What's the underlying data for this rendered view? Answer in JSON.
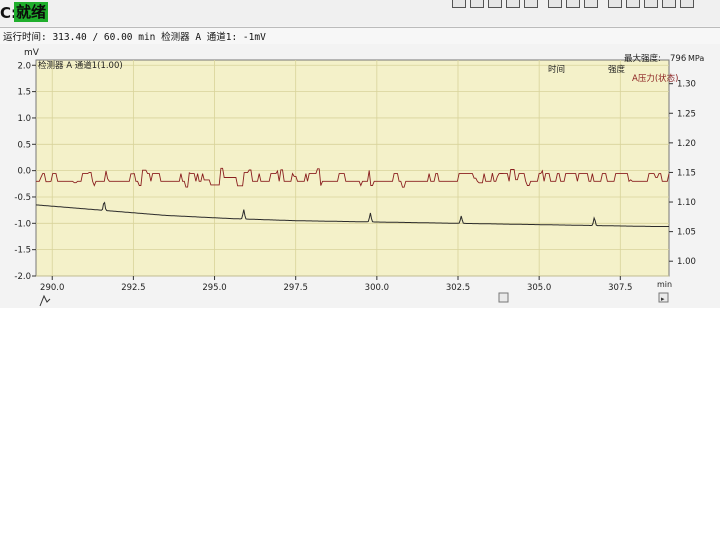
{
  "status": {
    "prefix": "C:",
    "badge": "就绪"
  },
  "runtime": {
    "text": "运行时间: 313.40 / 60.00 min 检测器 A 通道1: -1mV"
  },
  "legend": {
    "channel": "检测器 A 通道1(1.00)",
    "time_header": "时间",
    "intensity_header": "强度",
    "max_intensity_label": "最大强度:",
    "max_intensity_value": "796",
    "right_unit": "MPa",
    "pressure_label": "A压力(状态)"
  },
  "colors": {
    "status_badge": "#1fae2c",
    "plot_bg": "#f4f1c9",
    "pressure_trace": "#8a1f1f",
    "detector_trace": "#2b2b2b",
    "grid": "#d8d39a"
  },
  "chart_data": {
    "type": "line",
    "xlabel": "min",
    "ylabel": "mV",
    "y2label": "MPa",
    "xlim": [
      289.5,
      309.0
    ],
    "ylim": [
      -2.0,
      2.1
    ],
    "y2lim": [
      0.975,
      1.34
    ],
    "x_ticks": [
      290.0,
      292.5,
      295.0,
      297.5,
      300.0,
      302.5,
      305.0,
      307.5
    ],
    "x_tick_labels": [
      "290.0",
      "292.5",
      "295.0",
      "297.5",
      "300.0",
      "302.5",
      "305.0",
      "307.5"
    ],
    "y_ticks": [
      2.0,
      1.5,
      1.0,
      0.5,
      0.0,
      -0.5,
      -1.0,
      -1.5,
      -2.0
    ],
    "y_tick_labels": [
      "2.0",
      "1.5",
      "1.0",
      "0.5",
      "0.0",
      "-0.5",
      "-1.0",
      "-1.5",
      "-2.0"
    ],
    "y2_ticks": [
      1.3,
      1.25,
      1.2,
      1.15,
      1.1,
      1.05,
      1.0
    ],
    "y2_tick_labels": [
      "1.30",
      "1.25",
      "1.20",
      "1.15",
      "1.10",
      "1.05",
      "1.00"
    ],
    "series": [
      {
        "name": "检测器 A 通道1(1.00)",
        "axis": "left",
        "x": [
          289.5,
          290.5,
          291.5,
          292.5,
          293.5,
          294.5,
          295.5,
          296.5,
          297.5,
          298.5,
          299.5,
          300.5,
          301.5,
          302.5,
          303.5,
          304.5,
          305.5,
          306.5,
          307.5,
          308.5,
          309.0
        ],
        "values": [
          -0.65,
          -0.7,
          -0.75,
          -0.8,
          -0.85,
          -0.88,
          -0.91,
          -0.93,
          -0.95,
          -0.96,
          -0.97,
          -0.98,
          -0.99,
          -1.0,
          -1.01,
          -1.02,
          -1.03,
          -1.04,
          -1.05,
          -1.06,
          -1.06
        ],
        "peaks": [
          {
            "x": 291.6,
            "height": 0.17
          },
          {
            "x": 295.9,
            "height": 0.18
          },
          {
            "x": 299.8,
            "height": 0.17
          },
          {
            "x": 302.6,
            "height": 0.14
          },
          {
            "x": 306.7,
            "height": 0.15
          }
        ]
      },
      {
        "name": "A压力(状态)",
        "axis": "right",
        "baseline": 1.142,
        "levels": [
          1.135,
          1.148
        ],
        "range": [
          1.125,
          1.158
        ]
      }
    ],
    "grid": true
  }
}
